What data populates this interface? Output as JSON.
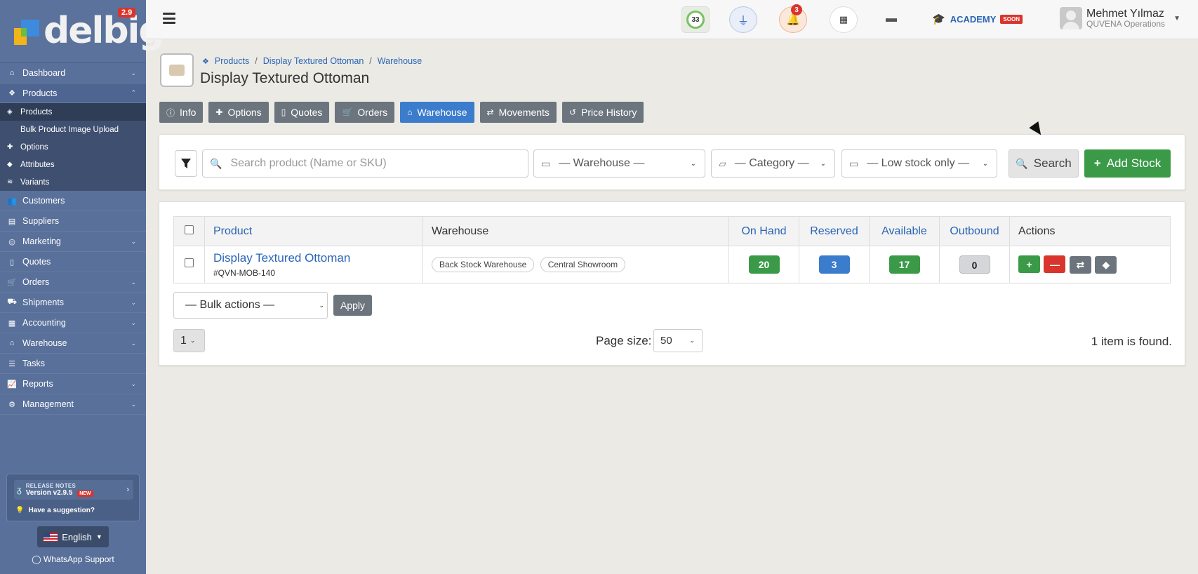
{
  "sidebar": {
    "logo_text": "delbig",
    "version_badge": "2.9",
    "items": [
      {
        "label": "Dashboard",
        "icon": "home-icon",
        "chevron": true
      },
      {
        "label": "Products",
        "icon": "cubes-icon",
        "chevron": true,
        "active": true
      },
      {
        "label": "Customers",
        "icon": "users-icon"
      },
      {
        "label": "Suppliers",
        "icon": "book-icon"
      },
      {
        "label": "Marketing",
        "icon": "bullseye-icon",
        "chevron": true
      },
      {
        "label": "Quotes",
        "icon": "file-icon"
      },
      {
        "label": "Orders",
        "icon": "cart-icon",
        "chevron": true
      },
      {
        "label": "Shipments",
        "icon": "truck-icon",
        "chevron": true
      },
      {
        "label": "Accounting",
        "icon": "calculator-icon",
        "chevron": true
      },
      {
        "label": "Warehouse",
        "icon": "warehouse-icon",
        "chevron": true
      },
      {
        "label": "Tasks",
        "icon": "list-icon"
      },
      {
        "label": "Reports",
        "icon": "chart-icon",
        "chevron": true
      },
      {
        "label": "Management",
        "icon": "gears-icon",
        "chevron": true
      }
    ],
    "sub_items": [
      {
        "label": "Products",
        "active": true
      },
      {
        "label": "Bulk Product Image Upload"
      },
      {
        "label": "Options"
      },
      {
        "label": "Attributes"
      },
      {
        "label": "Variants"
      }
    ],
    "release": {
      "title": "RELEASE NOTES",
      "version": "Version v2.9.5",
      "new_badge": "NEW",
      "suggestion": "Have a suggestion?"
    },
    "language": "English",
    "whatsapp": "WhatsApp Support"
  },
  "topbar": {
    "score": "33",
    "notif_count": "3",
    "academy": "ACADEMY",
    "academy_badge": "SOON",
    "user_name": "Mehmet Yılmaz",
    "user_org": "QUVENA Operations"
  },
  "breadcrumb": [
    "Products",
    "Display Textured Ottoman",
    "Warehouse"
  ],
  "page_title": "Display Textured Ottoman",
  "tabs": [
    {
      "label": "Info",
      "icon": "info-icon"
    },
    {
      "label": "Options",
      "icon": "puzzle-icon"
    },
    {
      "label": "Quotes",
      "icon": "file-icon"
    },
    {
      "label": "Orders",
      "icon": "cart-icon"
    },
    {
      "label": "Warehouse",
      "icon": "warehouse-icon",
      "active": true
    },
    {
      "label": "Movements",
      "icon": "exchange-icon"
    },
    {
      "label": "Price History",
      "icon": "history-icon"
    }
  ],
  "filters": {
    "search_placeholder": "Search product (Name or SKU)",
    "warehouse": "— Warehouse —",
    "category": "— Category —",
    "low_stock": "— Low stock only —",
    "search_button": "Search",
    "add_button": "Add Stock"
  },
  "table": {
    "headers": {
      "product": "Product",
      "warehouse": "Warehouse",
      "on_hand": "On Hand",
      "reserved": "Reserved",
      "available": "Available",
      "outbound": "Outbound",
      "actions": "Actions"
    },
    "row": {
      "name": "Display Textured Ottoman",
      "sku": "#QVN-MOB-140",
      "warehouses": [
        "Back Stock Warehouse",
        "Central Showroom"
      ],
      "on_hand": "20",
      "reserved": "3",
      "available": "17",
      "outbound": "0"
    }
  },
  "footer": {
    "bulk_actions": "— Bulk actions —",
    "apply": "Apply",
    "page": "1",
    "page_size_label": "Page size:",
    "page_size": "50",
    "found": "1 item is found."
  },
  "colors": {
    "sidebar": "#59709a",
    "primary": "#3c7ccc",
    "success": "#3a9a48",
    "danger": "#d9352c",
    "secondary": "#6c757d"
  }
}
